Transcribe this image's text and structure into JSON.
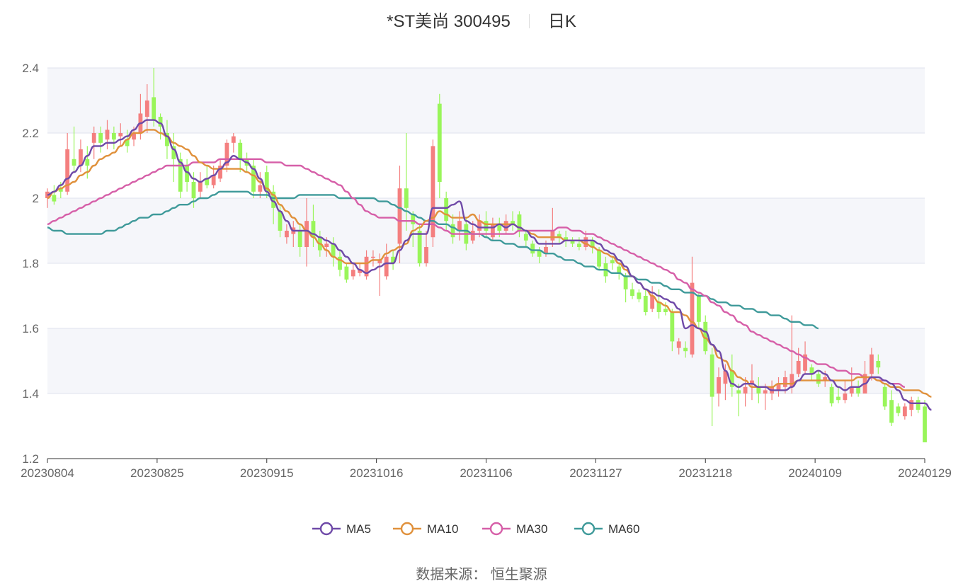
{
  "header": {
    "stock": "*ST美尚 300495",
    "period": "日K"
  },
  "source": "数据来源： 恒生聚源",
  "colors": {
    "up": "#f47f7f",
    "down": "#99f55a",
    "ma5": "#6f4aa8",
    "ma10": "#e0913c",
    "ma30": "#d65fa8",
    "ma60": "#3f9a9a",
    "grid": "#dfe3ee",
    "band": "#f5f6fa"
  },
  "chart_data": {
    "type": "candlestick",
    "ylim": [
      1.2,
      2.4
    ],
    "yticks": [
      "1.2",
      "1.4",
      "1.6",
      "1.8",
      "2",
      "2.2",
      "2.4"
    ],
    "xticks": [
      "20230804",
      "20230825",
      "20230915",
      "20231016",
      "20231106",
      "20231127",
      "20231218",
      "20240109",
      "20240129"
    ],
    "legend": [
      "MA5",
      "MA10",
      "MA30",
      "MA60"
    ],
    "legend_position": "bottom-center",
    "candles": [
      [
        2.0,
        2.02,
        2.03,
        1.97
      ],
      [
        2.01,
        1.99,
        2.04,
        1.98
      ],
      [
        2.03,
        2.02,
        2.05,
        2.0
      ],
      [
        2.02,
        2.15,
        2.2,
        2.01
      ],
      [
        2.12,
        2.1,
        2.22,
        2.08
      ],
      [
        2.1,
        2.15,
        2.18,
        2.08
      ],
      [
        2.12,
        2.1,
        2.16,
        2.06
      ],
      [
        2.17,
        2.2,
        2.22,
        2.12
      ],
      [
        2.2,
        2.17,
        2.22,
        2.14
      ],
      [
        2.18,
        2.21,
        2.24,
        2.15
      ],
      [
        2.2,
        2.18,
        2.22,
        2.15
      ],
      [
        2.19,
        2.2,
        2.23,
        2.16
      ],
      [
        2.18,
        2.16,
        2.21,
        2.14
      ],
      [
        2.18,
        2.2,
        2.22,
        2.16
      ],
      [
        2.2,
        2.26,
        2.32,
        2.18
      ],
      [
        2.25,
        2.3,
        2.35,
        2.2
      ],
      [
        2.31,
        2.24,
        2.4,
        2.22
      ],
      [
        2.25,
        2.22,
        2.26,
        2.18
      ],
      [
        2.2,
        2.16,
        2.24,
        2.12
      ],
      [
        2.16,
        2.12,
        2.2,
        2.05
      ],
      [
        2.12,
        2.02,
        2.14,
        2.0
      ],
      [
        2.1,
        2.05,
        2.12,
        2.02
      ],
      [
        2.05,
        2.0,
        2.08,
        1.97
      ],
      [
        2.02,
        2.05,
        2.08,
        2.0
      ],
      [
        2.06,
        2.04,
        2.1,
        2.03
      ],
      [
        2.04,
        2.07,
        2.1,
        2.03
      ],
      [
        2.06,
        2.1,
        2.12,
        2.05
      ],
      [
        2.1,
        2.17,
        2.18,
        2.08
      ],
      [
        2.17,
        2.19,
        2.2,
        2.14
      ],
      [
        2.17,
        2.12,
        2.18,
        2.08
      ],
      [
        2.12,
        2.1,
        2.14,
        2.08
      ],
      [
        2.1,
        2.02,
        2.12,
        2.0
      ],
      [
        2.02,
        2.04,
        2.08,
        2.0
      ],
      [
        2.08,
        2.02,
        2.1,
        2.0
      ],
      [
        2.02,
        1.97,
        2.04,
        1.92
      ],
      [
        1.96,
        1.9,
        1.98,
        1.88
      ],
      [
        1.88,
        1.9,
        1.92,
        1.86
      ],
      [
        1.89,
        1.91,
        1.93,
        1.85
      ],
      [
        1.9,
        1.85,
        1.92,
        1.82
      ],
      [
        1.85,
        1.93,
        2.0,
        1.79
      ],
      [
        1.93,
        1.88,
        1.98,
        1.85
      ],
      [
        1.88,
        1.84,
        1.9,
        1.82
      ],
      [
        1.85,
        1.86,
        1.88,
        1.82
      ],
      [
        1.86,
        1.82,
        1.88,
        1.79
      ],
      [
        1.82,
        1.78,
        1.84,
        1.76
      ],
      [
        1.79,
        1.75,
        1.8,
        1.74
      ],
      [
        1.76,
        1.78,
        1.8,
        1.75
      ],
      [
        1.77,
        1.78,
        1.8,
        1.76
      ],
      [
        1.76,
        1.82,
        1.84,
        1.75
      ],
      [
        1.82,
        1.82,
        1.84,
        1.79
      ],
      [
        1.8,
        1.81,
        1.83,
        1.7
      ],
      [
        1.76,
        1.82,
        1.86,
        1.75
      ],
      [
        1.82,
        1.8,
        1.84,
        1.78
      ],
      [
        1.86,
        2.03,
        2.1,
        1.8
      ],
      [
        2.03,
        1.97,
        2.2,
        1.9
      ],
      [
        1.95,
        1.92,
        1.96,
        1.85
      ],
      [
        1.9,
        1.8,
        1.92,
        1.79
      ],
      [
        1.8,
        1.85,
        1.9,
        1.79
      ],
      [
        1.88,
        2.16,
        2.18,
        1.85
      ],
      [
        2.29,
        2.05,
        2.32,
        2.0
      ],
      [
        2.0,
        1.93,
        2.02,
        1.9
      ],
      [
        1.92,
        1.88,
        1.95,
        1.86
      ],
      [
        1.9,
        1.93,
        1.96,
        1.87
      ],
      [
        1.92,
        1.86,
        1.94,
        1.84
      ],
      [
        1.87,
        1.9,
        1.93,
        1.86
      ],
      [
        1.9,
        1.93,
        1.95,
        1.88
      ],
      [
        1.93,
        1.9,
        1.96,
        1.88
      ],
      [
        1.88,
        1.92,
        1.94,
        1.87
      ],
      [
        1.92,
        1.9,
        1.94,
        1.88
      ],
      [
        1.9,
        1.93,
        1.95,
        1.89
      ],
      [
        1.93,
        1.92,
        1.96,
        1.9
      ],
      [
        1.95,
        1.9,
        1.96,
        1.88
      ],
      [
        1.89,
        1.87,
        1.9,
        1.85
      ],
      [
        1.86,
        1.83,
        1.87,
        1.82
      ],
      [
        1.84,
        1.82,
        1.85,
        1.8
      ],
      [
        1.83,
        1.85,
        1.87,
        1.82
      ],
      [
        1.87,
        1.9,
        1.97,
        1.85
      ],
      [
        1.89,
        1.88,
        1.9,
        1.86
      ],
      [
        1.88,
        1.87,
        1.9,
        1.85
      ],
      [
        1.87,
        1.86,
        1.88,
        1.85
      ],
      [
        1.86,
        1.85,
        1.88,
        1.84
      ],
      [
        1.85,
        1.88,
        1.9,
        1.84
      ],
      [
        1.87,
        1.85,
        1.88,
        1.83
      ],
      [
        1.84,
        1.79,
        1.85,
        1.78
      ],
      [
        1.8,
        1.76,
        1.82,
        1.74
      ],
      [
        1.81,
        1.8,
        1.82,
        1.78
      ],
      [
        1.79,
        1.77,
        1.8,
        1.75
      ],
      [
        1.76,
        1.72,
        1.77,
        1.68
      ],
      [
        1.72,
        1.7,
        1.74,
        1.69
      ],
      [
        1.71,
        1.69,
        1.72,
        1.68
      ],
      [
        1.7,
        1.65,
        1.72,
        1.64
      ],
      [
        1.66,
        1.7,
        1.73,
        1.65
      ],
      [
        1.68,
        1.65,
        1.72,
        1.63
      ],
      [
        1.66,
        1.65,
        1.68,
        1.64
      ],
      [
        1.65,
        1.56,
        1.66,
        1.53
      ],
      [
        1.54,
        1.56,
        1.57,
        1.52
      ],
      [
        1.54,
        1.53,
        1.56,
        1.51
      ],
      [
        1.52,
        1.74,
        1.82,
        1.51
      ],
      [
        1.7,
        1.62,
        1.71,
        1.6
      ],
      [
        1.62,
        1.53,
        1.64,
        1.52
      ],
      [
        1.52,
        1.39,
        1.54,
        1.3
      ],
      [
        1.4,
        1.45,
        1.48,
        1.36
      ],
      [
        1.43,
        1.47,
        1.49,
        1.38
      ],
      [
        1.47,
        1.42,
        1.52,
        1.39
      ],
      [
        1.41,
        1.4,
        1.43,
        1.33
      ],
      [
        1.4,
        1.42,
        1.45,
        1.36
      ],
      [
        1.43,
        1.44,
        1.49,
        1.38
      ],
      [
        1.42,
        1.4,
        1.45,
        1.37
      ],
      [
        1.4,
        1.41,
        1.43,
        1.35
      ],
      [
        1.4,
        1.42,
        1.44,
        1.38
      ],
      [
        1.41,
        1.43,
        1.45,
        1.39
      ],
      [
        1.42,
        1.45,
        1.47,
        1.4
      ],
      [
        1.42,
        1.46,
        1.64,
        1.4
      ],
      [
        1.46,
        1.5,
        1.54,
        1.45
      ],
      [
        1.47,
        1.52,
        1.56,
        1.46
      ],
      [
        1.48,
        1.46,
        1.49,
        1.44
      ],
      [
        1.46,
        1.43,
        1.47,
        1.42
      ],
      [
        1.44,
        1.45,
        1.47,
        1.42
      ],
      [
        1.42,
        1.37,
        1.43,
        1.36
      ],
      [
        1.39,
        1.38,
        1.42,
        1.37
      ],
      [
        1.38,
        1.4,
        1.44,
        1.37
      ],
      [
        1.4,
        1.42,
        1.48,
        1.39
      ],
      [
        1.42,
        1.4,
        1.44,
        1.39
      ],
      [
        1.4,
        1.46,
        1.5,
        1.4
      ],
      [
        1.46,
        1.52,
        1.54,
        1.44
      ],
      [
        1.5,
        1.48,
        1.52,
        1.46
      ],
      [
        1.42,
        1.36,
        1.43,
        1.35
      ],
      [
        1.38,
        1.31,
        1.41,
        1.3
      ],
      [
        1.36,
        1.34,
        1.37,
        1.33
      ],
      [
        1.33,
        1.36,
        1.37,
        1.32
      ],
      [
        1.35,
        1.38,
        1.39,
        1.33
      ],
      [
        1.38,
        1.35,
        1.39,
        1.34
      ],
      [
        1.36,
        1.25,
        1.38,
        1.25
      ]
    ],
    "series": [
      {
        "name": "MA5",
        "values": [
          2.01,
          2.02,
          2.04,
          2.06,
          2.08,
          2.1,
          2.13,
          2.16,
          2.16,
          2.17,
          2.17,
          2.18,
          2.19,
          2.21,
          2.23,
          2.24,
          2.24,
          2.23,
          2.19,
          2.15,
          2.11,
          2.08,
          2.06,
          2.05,
          2.06,
          2.07,
          2.09,
          2.11,
          2.13,
          2.12,
          2.11,
          2.09,
          2.06,
          2.02,
          1.99,
          1.96,
          1.93,
          1.9,
          1.9,
          1.9,
          1.89,
          1.88,
          1.87,
          1.86,
          1.84,
          1.82,
          1.8,
          1.78,
          1.77,
          1.78,
          1.79,
          1.8,
          1.8,
          1.84,
          1.87,
          1.89,
          1.89,
          1.89,
          1.97,
          1.97,
          1.97,
          1.98,
          1.99,
          1.93,
          1.92,
          1.91,
          1.91,
          1.91,
          1.92,
          1.91,
          1.92,
          1.91,
          1.9,
          1.88,
          1.86,
          1.86,
          1.86,
          1.86,
          1.87,
          1.87,
          1.87,
          1.87,
          1.87,
          1.86,
          1.84,
          1.83,
          1.81,
          1.79,
          1.76,
          1.74,
          1.72,
          1.71,
          1.7,
          1.69,
          1.68,
          1.66,
          1.6,
          1.61,
          1.6,
          1.59,
          1.55,
          1.53,
          1.47,
          1.43,
          1.42,
          1.43,
          1.43,
          1.42,
          1.42,
          1.41,
          1.41,
          1.41,
          1.42,
          1.44,
          1.46,
          1.46,
          1.47,
          1.46,
          1.44,
          1.42,
          1.41,
          1.42,
          1.42,
          1.43,
          1.45,
          1.45,
          1.44,
          1.43,
          1.41,
          1.38,
          1.37,
          1.37,
          1.37,
          1.35
        ]
      },
      {
        "name": "MA10",
        "values": [
          2.0,
          2.02,
          2.03,
          2.04,
          2.05,
          2.07,
          2.08,
          2.1,
          2.12,
          2.13,
          2.14,
          2.16,
          2.18,
          2.2,
          2.2,
          2.21,
          2.21,
          2.2,
          2.19,
          2.17,
          2.16,
          2.15,
          2.13,
          2.11,
          2.1,
          2.09,
          2.09,
          2.09,
          2.09,
          2.09,
          2.08,
          2.07,
          2.05,
          2.03,
          2.01,
          1.98,
          1.96,
          1.94,
          1.92,
          1.9,
          1.88,
          1.86,
          1.84,
          1.82,
          1.81,
          1.8,
          1.8,
          1.8,
          1.8,
          1.81,
          1.81,
          1.83,
          1.84,
          1.85,
          1.86,
          1.9,
          1.91,
          1.93,
          1.94,
          1.96,
          1.95,
          1.94,
          1.94,
          1.94,
          1.95,
          1.93,
          1.92,
          1.92,
          1.92,
          1.92,
          1.92,
          1.91,
          1.9,
          1.89,
          1.88,
          1.88,
          1.88,
          1.88,
          1.87,
          1.87,
          1.87,
          1.86,
          1.85,
          1.84,
          1.83,
          1.82,
          1.8,
          1.78,
          1.76,
          1.74,
          1.72,
          1.7,
          1.68,
          1.67,
          1.65,
          1.65,
          1.64,
          1.62,
          1.6,
          1.57,
          1.55,
          1.51,
          1.5,
          1.47,
          1.45,
          1.44,
          1.42,
          1.42,
          1.42,
          1.42,
          1.43,
          1.43,
          1.43,
          1.44,
          1.44,
          1.44,
          1.44,
          1.44,
          1.44,
          1.44,
          1.44,
          1.44,
          1.45,
          1.45,
          1.45,
          1.44,
          1.43,
          1.42,
          1.42,
          1.41,
          1.41,
          1.41,
          1.4,
          1.39
        ]
      },
      {
        "name": "MA30",
        "values": [
          1.92,
          1.93,
          1.94,
          1.95,
          1.96,
          1.97,
          1.98,
          1.99,
          2.0,
          2.01,
          2.02,
          2.03,
          2.04,
          2.05,
          2.06,
          2.07,
          2.08,
          2.09,
          2.1,
          2.1,
          2.1,
          2.1,
          2.11,
          2.11,
          2.11,
          2.11,
          2.12,
          2.12,
          2.12,
          2.12,
          2.12,
          2.12,
          2.12,
          2.11,
          2.11,
          2.11,
          2.1,
          2.1,
          2.1,
          2.09,
          2.08,
          2.07,
          2.06,
          2.05,
          2.04,
          2.02,
          2.0,
          1.98,
          1.96,
          1.95,
          1.94,
          1.94,
          1.94,
          1.93,
          1.93,
          1.93,
          1.92,
          1.92,
          1.92,
          1.91,
          1.9,
          1.89,
          1.89,
          1.89,
          1.89,
          1.89,
          1.89,
          1.89,
          1.89,
          1.89,
          1.89,
          1.9,
          1.9,
          1.9,
          1.9,
          1.9,
          1.9,
          1.91,
          1.91,
          1.9,
          1.9,
          1.89,
          1.89,
          1.88,
          1.87,
          1.86,
          1.85,
          1.84,
          1.83,
          1.82,
          1.81,
          1.8,
          1.79,
          1.78,
          1.77,
          1.75,
          1.74,
          1.72,
          1.71,
          1.7,
          1.68,
          1.67,
          1.65,
          1.64,
          1.62,
          1.61,
          1.59,
          1.58,
          1.57,
          1.56,
          1.55,
          1.54,
          1.53,
          1.52,
          1.51,
          1.5,
          1.49,
          1.49,
          1.48,
          1.47,
          1.47,
          1.46,
          1.46,
          1.45,
          1.45,
          1.44,
          1.44,
          1.43,
          1.43,
          1.42
        ]
      },
      {
        "name": "MA60",
        "values": [
          1.91,
          1.9,
          1.9,
          1.89,
          1.89,
          1.89,
          1.89,
          1.89,
          1.89,
          1.9,
          1.9,
          1.91,
          1.92,
          1.93,
          1.94,
          1.94,
          1.95,
          1.95,
          1.96,
          1.97,
          1.98,
          1.98,
          1.99,
          2.0,
          2.0,
          2.01,
          2.02,
          2.02,
          2.02,
          2.02,
          2.02,
          2.01,
          2.01,
          2.01,
          2.0,
          2.0,
          2.0,
          2.0,
          2.01,
          2.01,
          2.01,
          2.01,
          2.01,
          2.01,
          2.0,
          2.0,
          2.0,
          2.0,
          2.0,
          2.0,
          1.99,
          1.99,
          1.98,
          1.97,
          1.96,
          1.95,
          1.94,
          1.93,
          1.93,
          1.92,
          1.92,
          1.91,
          1.9,
          1.9,
          1.89,
          1.89,
          1.88,
          1.87,
          1.87,
          1.86,
          1.86,
          1.85,
          1.85,
          1.84,
          1.84,
          1.83,
          1.83,
          1.82,
          1.81,
          1.81,
          1.8,
          1.79,
          1.79,
          1.78,
          1.78,
          1.77,
          1.77,
          1.76,
          1.76,
          1.75,
          1.75,
          1.74,
          1.74,
          1.73,
          1.72,
          1.72,
          1.71,
          1.71,
          1.7,
          1.7,
          1.69,
          1.68,
          1.68,
          1.67,
          1.67,
          1.66,
          1.66,
          1.65,
          1.65,
          1.64,
          1.64,
          1.63,
          1.62,
          1.62,
          1.61,
          1.61,
          1.6
        ]
      }
    ]
  }
}
